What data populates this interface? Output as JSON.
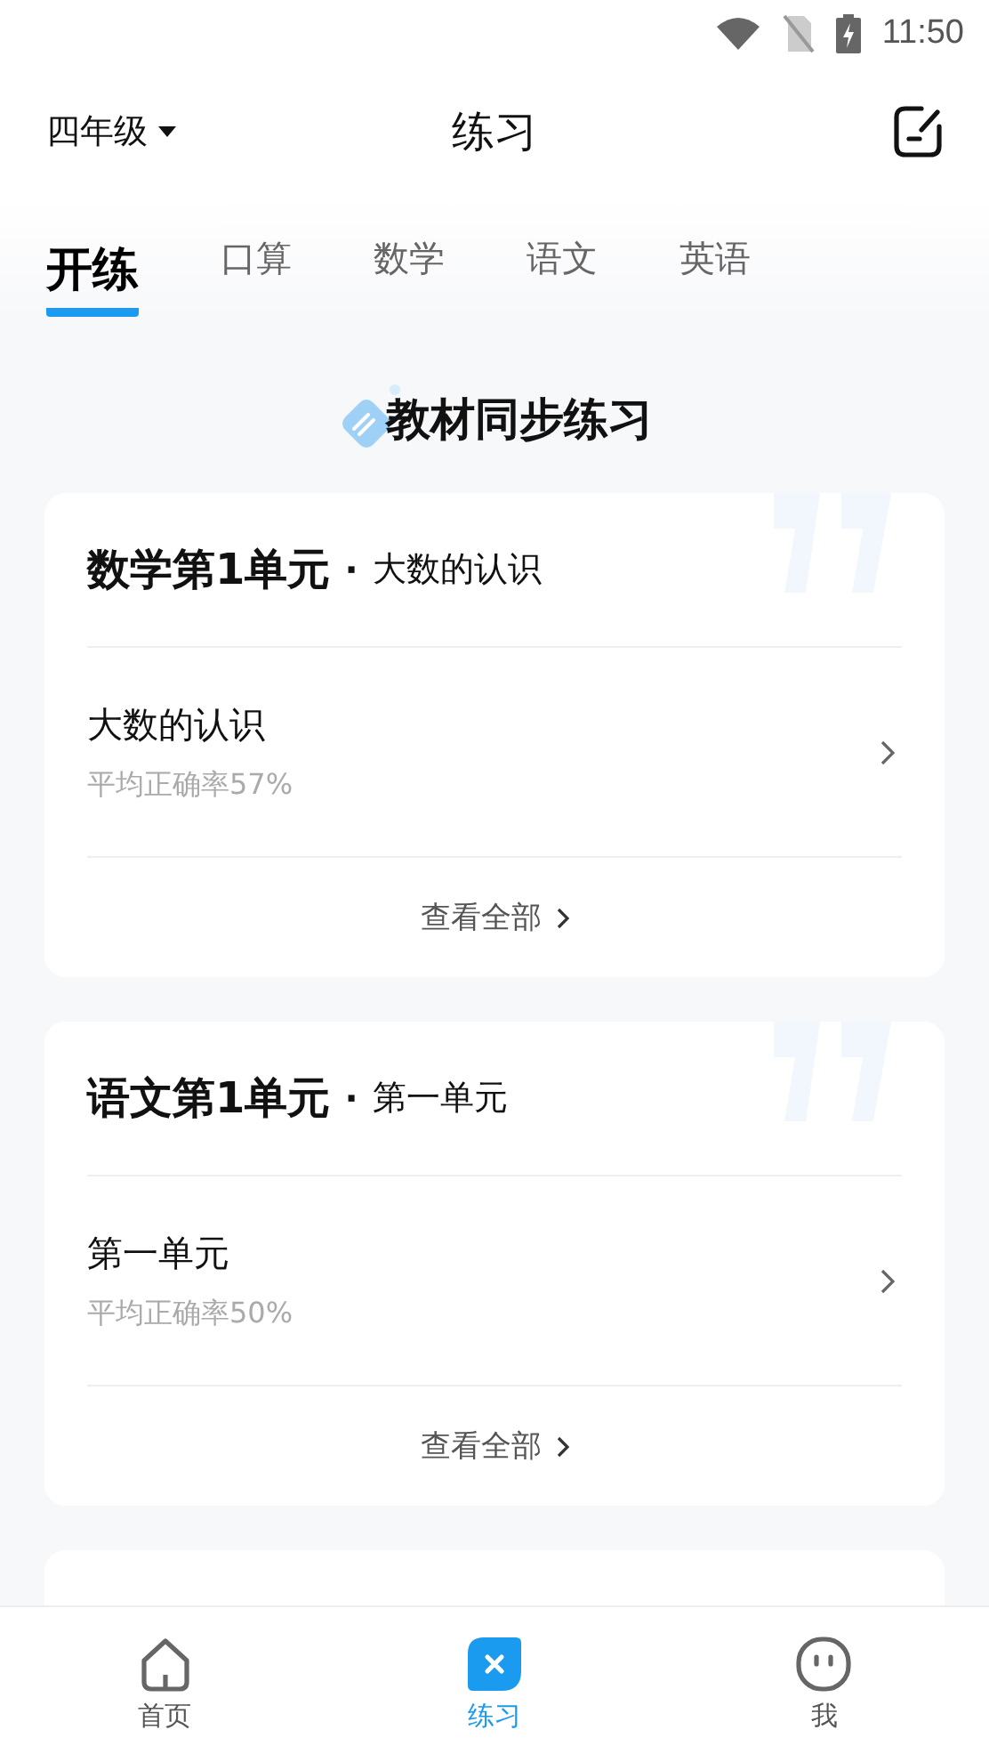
{
  "status_bar": {
    "time": "11:50"
  },
  "header": {
    "grade": "四年级",
    "title": "练习"
  },
  "tabs": [
    {
      "label": "开练",
      "selected": true
    },
    {
      "label": "口算",
      "selected": false
    },
    {
      "label": "数学",
      "selected": false
    },
    {
      "label": "语文",
      "selected": false
    },
    {
      "label": "英语",
      "selected": false
    }
  ],
  "section_title": "教材同步练习",
  "cards": [
    {
      "unit": "数学第1单元",
      "separator": "·",
      "subtitle": "大数的认识",
      "item_title": "大数的认识",
      "accuracy": "平均正确率57%",
      "view_all": "查看全部"
    },
    {
      "unit": "语文第1单元",
      "separator": "·",
      "subtitle": "第一单元",
      "item_title": "第一单元",
      "accuracy": "平均正确率50%",
      "view_all": "查看全部"
    }
  ],
  "bottom_nav": [
    {
      "label": "首页",
      "kind": "home",
      "selected": false
    },
    {
      "label": "练习",
      "kind": "practice",
      "selected": true
    },
    {
      "label": "我",
      "kind": "me",
      "selected": false
    }
  ]
}
